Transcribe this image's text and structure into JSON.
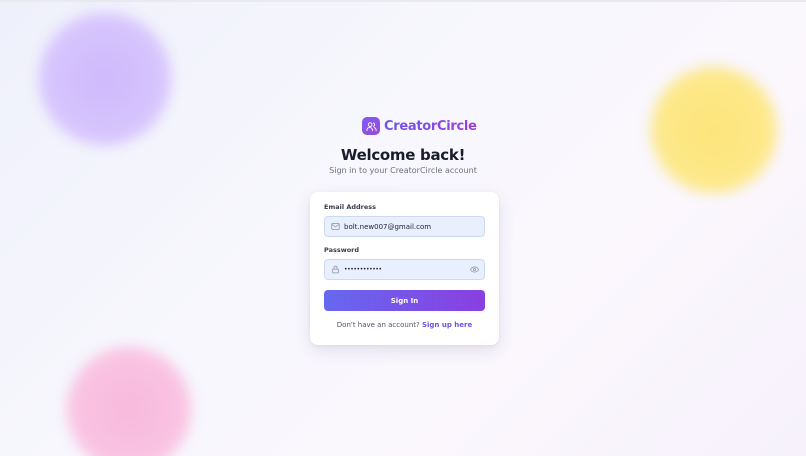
{
  "brand": {
    "name": "CreatorCircle",
    "logo_icon": "users-icon",
    "accent_start": "#7c5cf3",
    "accent_end": "#9b3fd8"
  },
  "heading": {
    "title": "Welcome back!",
    "subtitle": "Sign in to your CreatorCircle account"
  },
  "form": {
    "email": {
      "label": "Email Address",
      "value": "bolt.new007@gmail.com",
      "icon": "mail-icon"
    },
    "password": {
      "label": "Password",
      "value": "••••••••••••",
      "icon": "lock-icon",
      "toggle_icon": "eye-icon"
    },
    "submit_label": "Sign In",
    "signup_prompt": "Don't have an account?",
    "signup_link": "Sign up here"
  },
  "colors": {
    "field_bg": "#e8effd",
    "button_start": "#6668f0",
    "button_end": "#8a3fe0",
    "link": "#6a55e3"
  }
}
